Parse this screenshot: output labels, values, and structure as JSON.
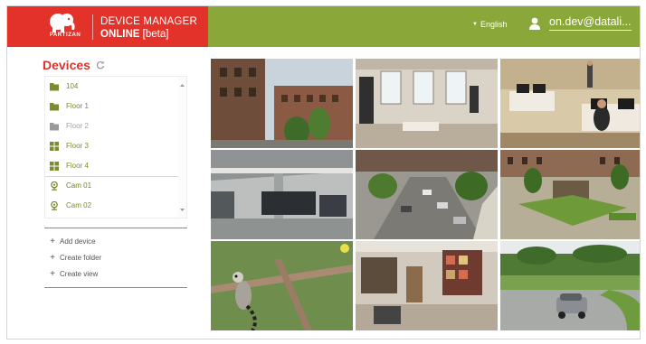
{
  "brand": {
    "logo_word": "PARTIZAN",
    "title": "DEVICE MANAGER",
    "subtitle_bold": "ONLINE",
    "subtitle_rest": " [beta]"
  },
  "header": {
    "language": "English",
    "user_email": "on.dev@datali..."
  },
  "sidebar": {
    "title": "Devices",
    "items": [
      {
        "label": "104",
        "icon": "folder-icon"
      },
      {
        "label": "Floor 1",
        "icon": "folder-icon"
      },
      {
        "label": "Floor 2",
        "icon": "folder-icon"
      },
      {
        "label": "Floor 3",
        "icon": "layout-icon"
      },
      {
        "label": "Floor 4",
        "icon": "layout-icon"
      },
      {
        "label": "Cam 01",
        "icon": "camera-icon"
      },
      {
        "label": "Cam 02",
        "icon": "camera-icon"
      }
    ],
    "actions": [
      {
        "label": "Add device"
      },
      {
        "label": "Create folder"
      },
      {
        "label": "Create view"
      }
    ]
  },
  "colors": {
    "brand_red": "#e2322a",
    "header_green": "#8aa83a",
    "item_green": "#7c8b2e"
  },
  "camera_grid": {
    "views": [
      {
        "scene": "brick buildings and trees"
      },
      {
        "scene": "office room with windows"
      },
      {
        "scene": "office with people at desks"
      },
      {
        "scene": "underground parking garage"
      },
      {
        "scene": "street with parked cars"
      },
      {
        "scene": "courtyard with gazebo"
      },
      {
        "scene": "lemur on a branch"
      },
      {
        "scene": "warehouse with shelves"
      },
      {
        "scene": "parking lot with car"
      }
    ]
  }
}
